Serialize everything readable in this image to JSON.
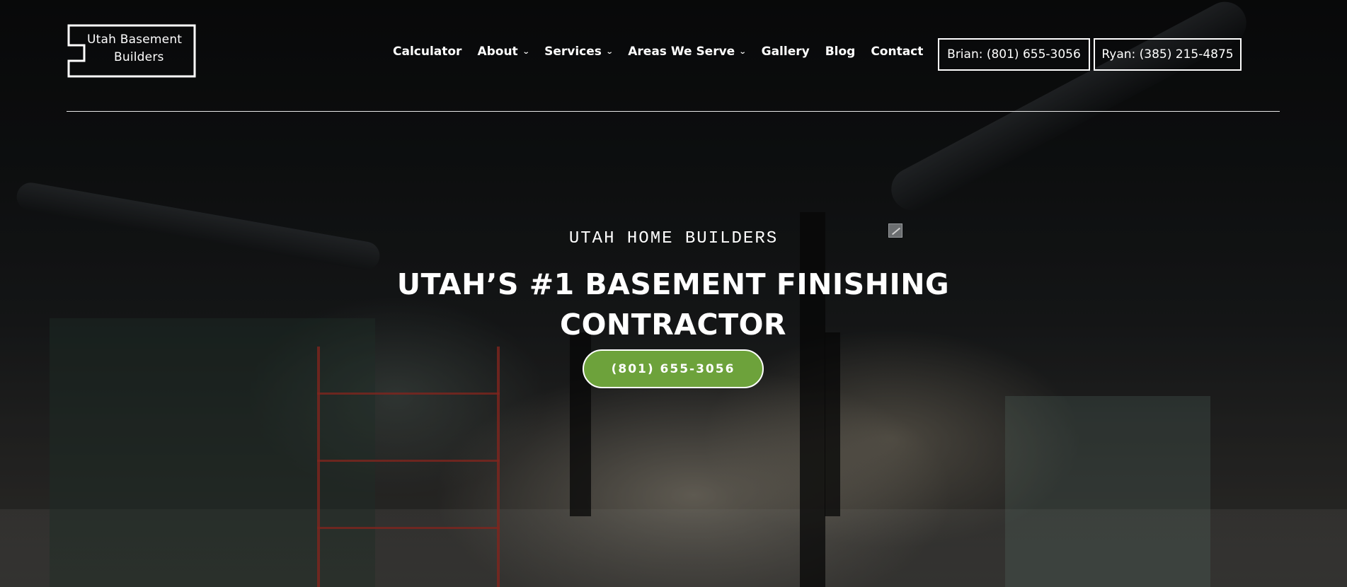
{
  "logo": {
    "line1": "Utah Basement",
    "line2": "Builders"
  },
  "nav": {
    "items": [
      {
        "label": "Calculator",
        "dropdown": false
      },
      {
        "label": "About",
        "dropdown": true
      },
      {
        "label": "Services",
        "dropdown": true
      },
      {
        "label": "Areas We Serve",
        "dropdown": true
      },
      {
        "label": "Gallery",
        "dropdown": false
      },
      {
        "label": "Blog",
        "dropdown": false
      },
      {
        "label": "Contact",
        "dropdown": false
      }
    ],
    "chevron_icon": "chevron-down-icon"
  },
  "phones": {
    "brian": "Brian: (801) 655-3056",
    "ryan": "Ryan: (385) 215-4875"
  },
  "hero": {
    "kicker": "UTAH HOME BUILDERS",
    "headline": "UTAH’S #1 BASEMENT FINISHING CONTRACTOR",
    "cta_label": "(801) 655-3056"
  },
  "colors": {
    "accent": "#6da23b",
    "text": "#ffffff",
    "background": "#0d0f10"
  }
}
